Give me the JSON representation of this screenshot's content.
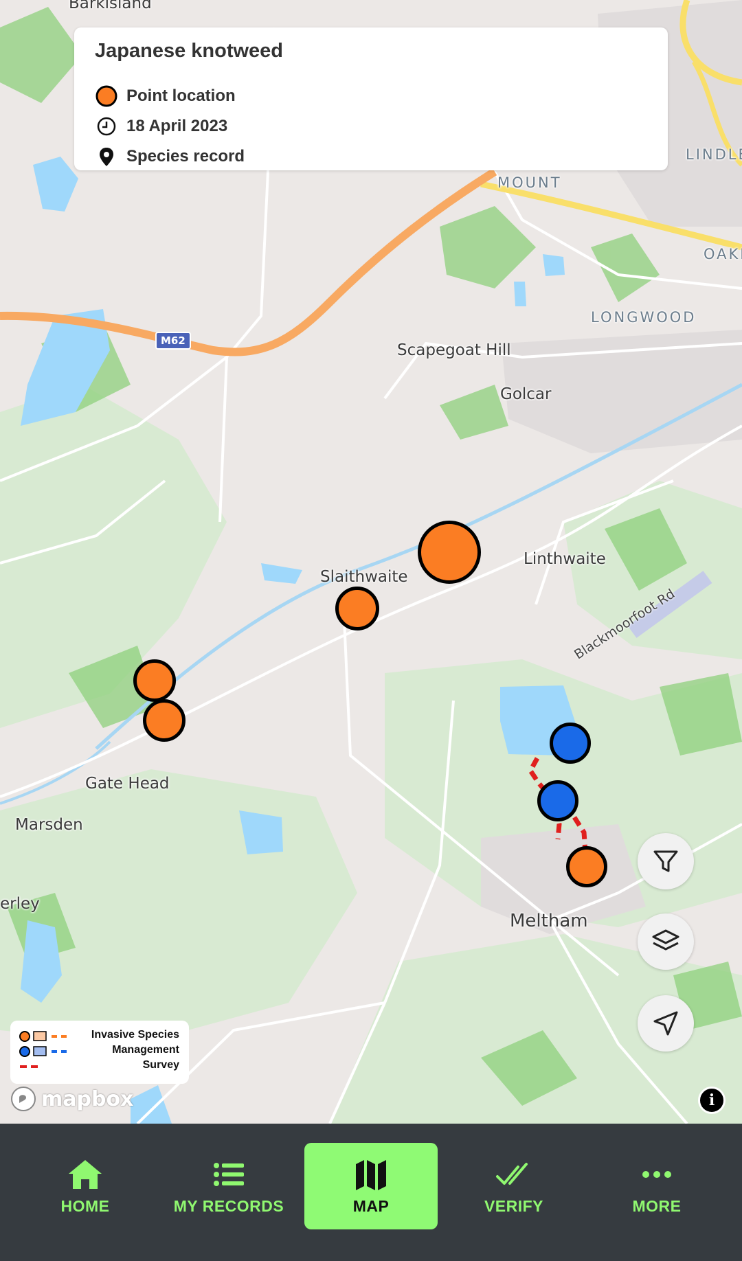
{
  "info_card": {
    "title": "Japanese knotweed",
    "geometry_label": "Point location",
    "date": "18 April 2023",
    "type_label": "Species record",
    "icons": [
      "orange-dot-icon",
      "clock-icon",
      "map-pin-icon"
    ]
  },
  "map": {
    "places": [
      "Scapegoat Hill",
      "Golcar",
      "Linthwaite",
      "Slaithwaite",
      "Gate Head",
      "Marsden",
      "Meltham",
      "erley",
      "Barkisland"
    ],
    "districts": [
      "MOUNT",
      "LINDLE",
      "OAKI",
      "LONGWOOD"
    ],
    "road_shield": "M62",
    "road_label": "Blackmoorfoot Rd",
    "marker_colors": {
      "orange": "#fb7d23",
      "blue": "#1a6ae8",
      "path_red": "#e0201e"
    }
  },
  "legend": {
    "lines": [
      "Invasive Species",
      "Management",
      "Survey"
    ]
  },
  "map_controls": {
    "filter": "filter-icon",
    "layers": "layers-icon",
    "locate": "locate-arrow-icon"
  },
  "attribution": {
    "logo_text": "mapbox"
  },
  "tabbar": {
    "tabs": [
      {
        "label": "HOME",
        "icon": "home-icon"
      },
      {
        "label": "MY RECORDS",
        "icon": "list-icon"
      },
      {
        "label": "MAP",
        "icon": "map-icon",
        "active": true
      },
      {
        "label": "VERIFY",
        "icon": "double-check-icon"
      },
      {
        "label": "MORE",
        "icon": "more-dots-icon"
      }
    ],
    "accent": "#8ffa74",
    "background": "#363b40"
  }
}
